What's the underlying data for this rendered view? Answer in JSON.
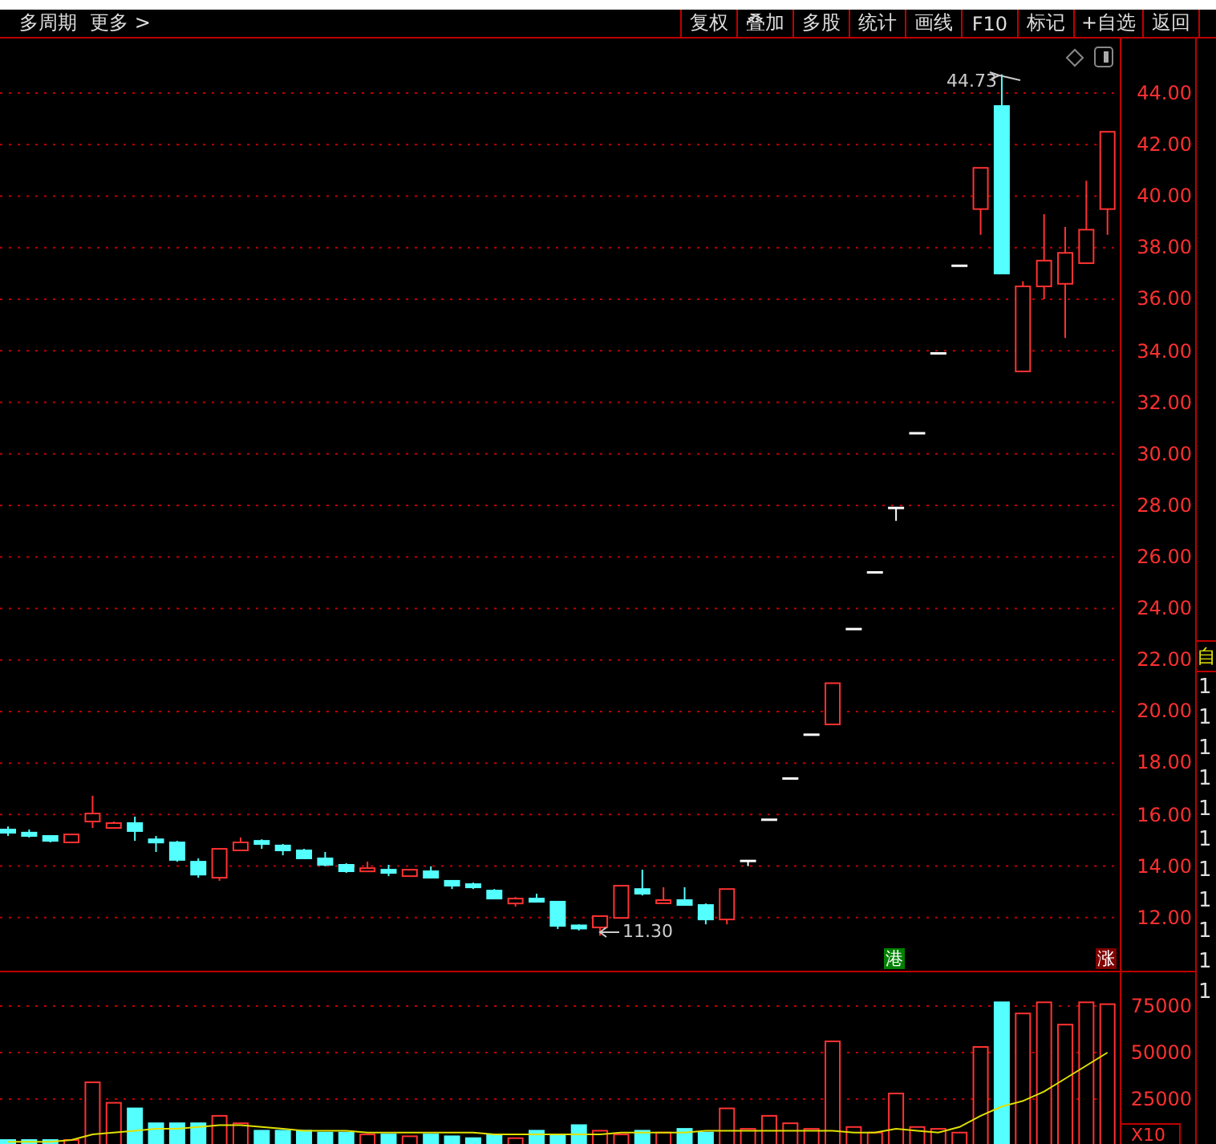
{
  "toolbar": {
    "left_items": [
      "多周期",
      "更多 >"
    ],
    "buttons": [
      "复权",
      "叠加",
      "多股",
      "统计",
      "画线",
      "F10",
      "标记",
      "+自选",
      "返回"
    ]
  },
  "price_chart": {
    "high_label": "44.73",
    "low_label": "11.30",
    "badges": [
      {
        "text": "港",
        "kind": "hk"
      },
      {
        "text": "涨",
        "kind": "rise"
      }
    ],
    "chart_data": {
      "type": "candlestick",
      "ylim": [
        9.94,
        46.12
      ],
      "grid": true,
      "yticks": [
        {
          "value": 44,
          "label": "44.00"
        },
        {
          "value": 42,
          "label": "42.00"
        },
        {
          "value": 40,
          "label": "40.00"
        },
        {
          "value": 38,
          "label": "38.00"
        },
        {
          "value": 36,
          "label": "36.00"
        },
        {
          "value": 34,
          "label": "34.00"
        },
        {
          "value": 32,
          "label": "32.00"
        },
        {
          "value": 30,
          "label": "30.00"
        },
        {
          "value": 28,
          "label": "28.00"
        },
        {
          "value": 26,
          "label": "26.00"
        },
        {
          "value": 24,
          "label": "24.00"
        },
        {
          "value": 22,
          "label": "22.00"
        },
        {
          "value": 20,
          "label": "20.00"
        },
        {
          "value": 18,
          "label": "18.00"
        },
        {
          "value": 16,
          "label": "16.00"
        },
        {
          "value": 14,
          "label": "14.00"
        },
        {
          "value": 12,
          "label": "12.00"
        }
      ],
      "ohlc": [
        [
          15.42,
          15.54,
          15.17,
          15.3
        ],
        [
          15.3,
          15.42,
          15.11,
          15.17
        ],
        [
          15.17,
          15.17,
          14.92,
          14.98
        ],
        [
          14.92,
          15.23,
          14.92,
          15.23
        ],
        [
          15.73,
          16.73,
          15.48,
          16.04
        ],
        [
          15.48,
          15.73,
          15.48,
          15.67
        ],
        [
          15.67,
          15.92,
          14.98,
          15.36
        ],
        [
          15.04,
          15.17,
          14.55,
          14.92
        ],
        [
          14.92,
          14.98,
          14.17,
          14.24
        ],
        [
          14.17,
          14.3,
          13.55,
          13.67
        ],
        [
          13.55,
          14.67,
          13.43,
          14.67
        ],
        [
          14.61,
          15.11,
          14.61,
          14.92
        ],
        [
          14.98,
          15.04,
          14.67,
          14.86
        ],
        [
          14.8,
          14.86,
          14.42,
          14.61
        ],
        [
          14.61,
          14.67,
          14.3,
          14.3
        ],
        [
          14.3,
          14.55,
          13.99,
          14.05
        ],
        [
          14.05,
          14.11,
          13.74,
          13.8
        ],
        [
          13.86,
          14.17,
          13.86,
          13.92
        ],
        [
          13.86,
          14.05,
          13.61,
          13.74
        ],
        [
          13.61,
          13.86,
          13.61,
          13.86
        ],
        [
          13.8,
          13.99,
          13.55,
          13.55
        ],
        [
          13.43,
          13.43,
          13.11,
          13.24
        ],
        [
          13.3,
          13.36,
          13.11,
          13.24
        ],
        [
          13.05,
          13.11,
          12.74,
          12.74
        ],
        [
          12.55,
          12.8,
          12.43,
          12.74
        ],
        [
          12.74,
          12.93,
          12.62,
          12.62
        ],
        [
          12.62,
          12.62,
          11.56,
          11.68
        ],
        [
          11.7,
          11.74,
          11.5,
          11.66
        ],
        [
          11.62,
          12.06,
          11.3,
          12.06
        ],
        [
          11.99,
          13.24,
          11.99,
          13.24
        ],
        [
          13.11,
          13.86,
          12.86,
          12.93
        ],
        [
          12.66,
          13.18,
          12.62,
          12.68
        ],
        [
          12.68,
          13.18,
          12.49,
          12.49
        ],
        [
          12.49,
          12.55,
          11.74,
          11.93
        ],
        [
          11.93,
          13.11,
          11.74,
          13.11
        ],
        [
          14.2,
          14.2,
          14.0,
          14.2
        ],
        [
          15.8,
          15.8,
          15.8,
          15.8
        ],
        [
          17.4,
          17.4,
          17.4,
          17.4
        ],
        [
          19.1,
          19.1,
          19.1,
          19.1
        ],
        [
          19.5,
          21.1,
          19.5,
          21.1
        ],
        [
          23.2,
          23.2,
          23.2,
          23.2
        ],
        [
          25.4,
          25.4,
          25.4,
          25.4
        ],
        [
          27.9,
          27.9,
          27.4,
          27.9
        ],
        [
          30.8,
          30.8,
          30.8,
          30.8
        ],
        [
          33.9,
          33.9,
          33.9,
          33.9
        ],
        [
          37.3,
          37.3,
          37.3,
          37.3
        ],
        [
          39.5,
          41.1,
          38.5,
          41.1
        ],
        [
          43.5,
          44.73,
          37,
          37
        ],
        [
          33.2,
          36.7,
          33.2,
          36.5
        ],
        [
          36.5,
          39.3,
          36,
          37.5
        ],
        [
          36.6,
          38.8,
          34.5,
          37.8
        ],
        [
          37.4,
          40.6,
          37.4,
          38.7
        ],
        [
          39.5,
          42.5,
          38.5,
          42.5
        ]
      ]
    }
  },
  "volume_chart": {
    "unit": "X10",
    "chart_data": {
      "type": "bar",
      "ylim": [
        0,
        93100
      ],
      "grid": true,
      "stacked": false,
      "yticks": [
        {
          "value": 75000,
          "label": "75000"
        },
        {
          "value": 50000,
          "label": "50000"
        },
        {
          "value": 25000,
          "label": "25000"
        }
      ],
      "series": [
        {
          "type": "bar",
          "colors": [
            "#54ffff",
            "#54ffff",
            "#54ffff",
            "#ff3232",
            "#ff3232",
            "#ff3232",
            "#54ffff",
            "#54ffff",
            "#54ffff",
            "#54ffff",
            "#ff3232",
            "#ff3232",
            "#54ffff",
            "#54ffff",
            "#54ffff",
            "#54ffff",
            "#54ffff",
            "#ff3232",
            "#54ffff",
            "#ff3232",
            "#54ffff",
            "#54ffff",
            "#54ffff",
            "#54ffff",
            "#ff3232",
            "#54ffff",
            "#54ffff",
            "#54ffff",
            "#ff3232",
            "#ff3232",
            "#54ffff",
            "#ff3232",
            "#54ffff",
            "#54ffff",
            "#ff3232",
            "#ff3232",
            "#ff3232",
            "#ff3232",
            "#ff3232",
            "#ff3232",
            "#ff3232",
            "#ff3232",
            "#ff3232",
            "#ff3232",
            "#ff3232",
            "#ff3232",
            "#ff3232",
            "#54ffff",
            "#ff3232",
            "#ff3232",
            "#ff3232",
            "#ff3232",
            "#ff3232"
          ],
          "values": [
            3000,
            3000,
            3000,
            3000,
            34000,
            23000,
            20000,
            12000,
            12000,
            12000,
            16000,
            12000,
            8000,
            8000,
            8000,
            7000,
            7000,
            6000,
            6000,
            5000,
            6000,
            5000,
            4000,
            6000,
            4000,
            8000,
            6000,
            11000,
            8000,
            6000,
            8000,
            7000,
            9000,
            7000,
            20000,
            9000,
            16000,
            12000,
            9000,
            56000,
            10000,
            7000,
            28000,
            10000,
            9000,
            7000,
            53000,
            77000,
            71000,
            77000,
            65000,
            77000,
            76000
          ]
        },
        {
          "type": "line",
          "color": "#e0e000",
          "values": [
            2000,
            2000,
            2000,
            3000,
            6000,
            7000,
            8000,
            9000,
            9000,
            10000,
            11000,
            11000,
            10000,
            9000,
            8000,
            8000,
            8000,
            7000,
            7000,
            7000,
            7000,
            7000,
            7000,
            6000,
            6000,
            6000,
            6000,
            6000,
            6000,
            7000,
            7000,
            7000,
            7000,
            8000,
            8000,
            8000,
            8000,
            8000,
            8000,
            8000,
            7000,
            7000,
            9000,
            8000,
            7000,
            10000,
            16000,
            21000,
            24000,
            29000,
            36000,
            43000,
            50000
          ]
        }
      ]
    }
  },
  "side_strip": {
    "marker": "自",
    "digits": [
      "1",
      "1",
      "1",
      "1",
      "1",
      "1",
      "1",
      "1",
      "1",
      "1",
      "1"
    ]
  }
}
